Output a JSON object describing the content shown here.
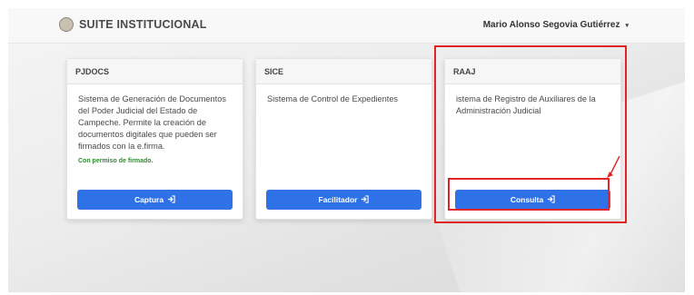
{
  "header": {
    "app_title": "SUITE INSTITUCIONAL",
    "user_name": "Mario Alonso Segovia Gutiérrez",
    "user_caret": "▾"
  },
  "cards": [
    {
      "title": "PJDOCS",
      "description": "Sistema de Generación de Documentos del Poder Judicial del Estado de Campeche. Permite la creación de documentos digitales que pueden ser firmados con la e.firma.",
      "note": "Con permiso de firmado.",
      "button_label": "Captura",
      "button_icon": "sign-in-icon"
    },
    {
      "title": "SICE",
      "description": "Sistema de Control de Expedientes",
      "note": "",
      "button_label": "Facilitador",
      "button_icon": "sign-in-icon"
    },
    {
      "title": "RAAJ",
      "description": "istema de Registro de Auxiliares de la Administración Judicial",
      "note": "",
      "button_label": "Consulta",
      "button_icon": "sign-in-icon"
    }
  ],
  "colors": {
    "button": "#2f72e8",
    "annotation": "#e12525",
    "permission_note": "#2e8b2e"
  }
}
